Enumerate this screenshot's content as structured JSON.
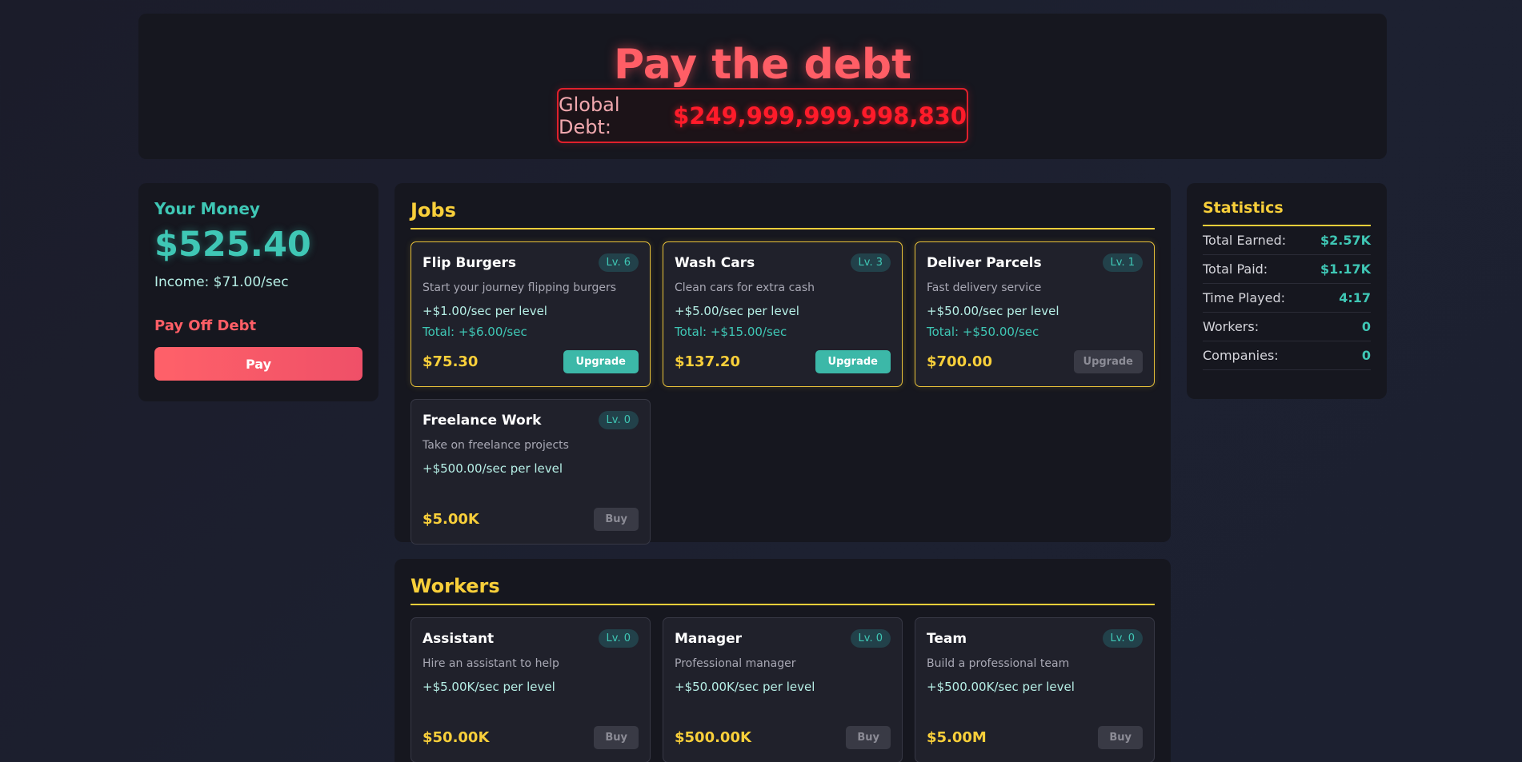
{
  "header": {
    "title": "Pay the debt",
    "debt_label": "Global Debt:",
    "debt_value": "$249,999,999,998,830"
  },
  "money": {
    "title": "Your Money",
    "value": "$525.40",
    "income": "Income: $71.00/sec",
    "debt_title": "Pay Off Debt",
    "pay_label": "Pay"
  },
  "jobs": {
    "title": "Jobs",
    "items": [
      {
        "name": "Flip Burgers",
        "level": "Lv. 6",
        "desc": "Start your journey flipping burgers",
        "rate": "+$1.00/sec per level",
        "total": "Total: +$6.00/sec",
        "cost": "$75.30",
        "button": "Upgrade"
      },
      {
        "name": "Wash Cars",
        "level": "Lv. 3",
        "desc": "Clean cars for extra cash",
        "rate": "+$5.00/sec per level",
        "total": "Total: +$15.00/sec",
        "cost": "$137.20",
        "button": "Upgrade"
      },
      {
        "name": "Deliver Parcels",
        "level": "Lv. 1",
        "desc": "Fast delivery service",
        "rate": "+$50.00/sec per level",
        "total": "Total: +$50.00/sec",
        "cost": "$700.00",
        "button": "Upgrade"
      },
      {
        "name": "Freelance Work",
        "level": "Lv. 0",
        "desc": "Take on freelance projects",
        "rate": "+$500.00/sec per level",
        "cost": "$5.00K",
        "button": "Buy"
      }
    ]
  },
  "workers": {
    "title": "Workers",
    "items": [
      {
        "name": "Assistant",
        "level": "Lv. 0",
        "desc": "Hire an assistant to help",
        "rate": "+$5.00K/sec per level",
        "cost": "$50.00K",
        "button": "Buy"
      },
      {
        "name": "Manager",
        "level": "Lv. 0",
        "desc": "Professional manager",
        "rate": "+$50.00K/sec per level",
        "cost": "$500.00K",
        "button": "Buy"
      },
      {
        "name": "Team",
        "level": "Lv. 0",
        "desc": "Build a professional team",
        "rate": "+$500.00K/sec per level",
        "cost": "$5.00M",
        "button": "Buy"
      }
    ]
  },
  "stats": {
    "title": "Statistics",
    "rows": [
      {
        "label": "Total Earned:",
        "value": "$2.57K"
      },
      {
        "label": "Total Paid:",
        "value": "$1.17K"
      },
      {
        "label": "Time Played:",
        "value": "4:17"
      },
      {
        "label": "Workers:",
        "value": "0"
      },
      {
        "label": "Companies:",
        "value": "0"
      }
    ]
  },
  "colors": {
    "accent_red": "#ff5e66",
    "debt_red": "#ff1b2a",
    "teal": "#3fc7b5",
    "gold": "#f8cf3a",
    "panel": "#16171f"
  }
}
